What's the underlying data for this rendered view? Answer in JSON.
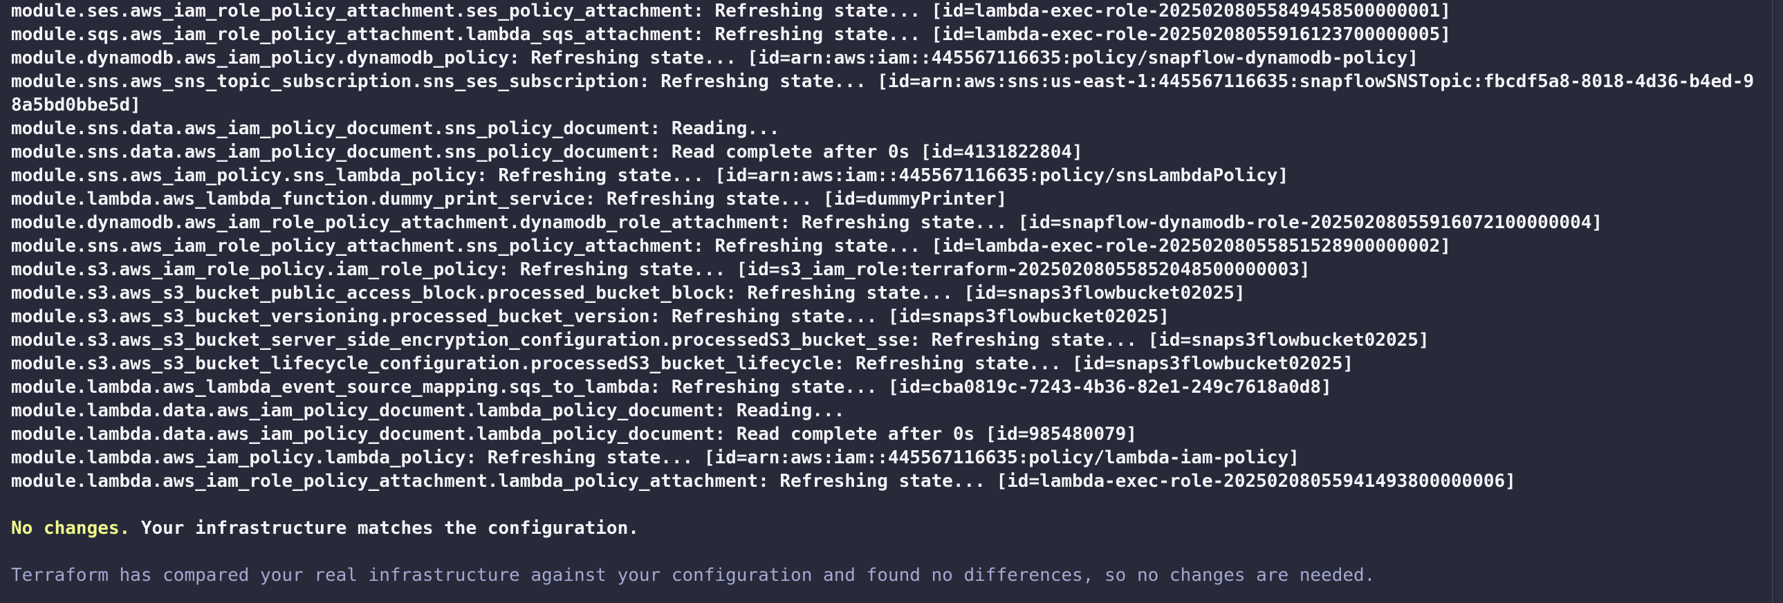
{
  "terminal": {
    "lines": [
      "module.ses.aws_iam_role_policy_attachment.ses_policy_attachment: Refreshing state... [id=lambda-exec-role-20250208055849458500000001]",
      "module.sqs.aws_iam_role_policy_attachment.lambda_sqs_attachment: Refreshing state... [id=lambda-exec-role-20250208055916123700000005]",
      "module.dynamodb.aws_iam_policy.dynamodb_policy: Refreshing state... [id=arn:aws:iam::445567116635:policy/snapflow-dynamodb-policy]",
      "module.sns.aws_sns_topic_subscription.sns_ses_subscription: Refreshing state... [id=arn:aws:sns:us-east-1:445567116635:snapflowSNSTopic:fbcdf5a8-8018-4d36-b4ed-98a5bd0bbe5d]",
      "module.sns.data.aws_iam_policy_document.sns_policy_document: Reading...",
      "module.sns.data.aws_iam_policy_document.sns_policy_document: Read complete after 0s [id=4131822804]",
      "module.sns.aws_iam_policy.sns_lambda_policy: Refreshing state... [id=arn:aws:iam::445567116635:policy/snsLambdaPolicy]",
      "module.lambda.aws_lambda_function.dummy_print_service: Refreshing state... [id=dummyPrinter]",
      "module.dynamodb.aws_iam_role_policy_attachment.dynamodb_role_attachment: Refreshing state... [id=snapflow-dynamodb-role-20250208055916072100000004]",
      "module.sns.aws_iam_role_policy_attachment.sns_policy_attachment: Refreshing state... [id=lambda-exec-role-20250208055851528900000002]",
      "module.s3.aws_iam_role_policy.iam_role_policy: Refreshing state... [id=s3_iam_role:terraform-20250208055852048500000003]",
      "module.s3.aws_s3_bucket_public_access_block.processed_bucket_block: Refreshing state... [id=snaps3flowbucket02025]",
      "module.s3.aws_s3_bucket_versioning.processed_bucket_version: Refreshing state... [id=snaps3flowbucket02025]",
      "module.s3.aws_s3_bucket_server_side_encryption_configuration.processedS3_bucket_sse: Refreshing state... [id=snaps3flowbucket02025]",
      "module.s3.aws_s3_bucket_lifecycle_configuration.processedS3_bucket_lifecycle: Refreshing state... [id=snaps3flowbucket02025]",
      "module.lambda.aws_lambda_event_source_mapping.sqs_to_lambda: Refreshing state... [id=cba0819c-7243-4b36-82e1-249c7618a0d8]",
      "module.lambda.data.aws_iam_policy_document.lambda_policy_document: Reading...",
      "module.lambda.data.aws_iam_policy_document.lambda_policy_document: Read complete after 0s [id=985480079]",
      "module.lambda.aws_iam_policy.lambda_policy: Refreshing state... [id=arn:aws:iam::445567116635:policy/lambda-iam-policy]",
      "module.lambda.aws_iam_role_policy_attachment.lambda_policy_attachment: Refreshing state... [id=lambda-exec-role-20250208055941493800000006]"
    ],
    "summary_strong": "No changes.",
    "summary_rest": " Your infrastructure matches the configuration.",
    "detail": "Terraform has compared your real infrastructure against your configuration and found no differences, so no changes are needed."
  },
  "colors": {
    "background": "#282a3a",
    "text": "#f4f4f8",
    "highlight": "#f1fa8c",
    "muted": "#a3a8d0"
  }
}
